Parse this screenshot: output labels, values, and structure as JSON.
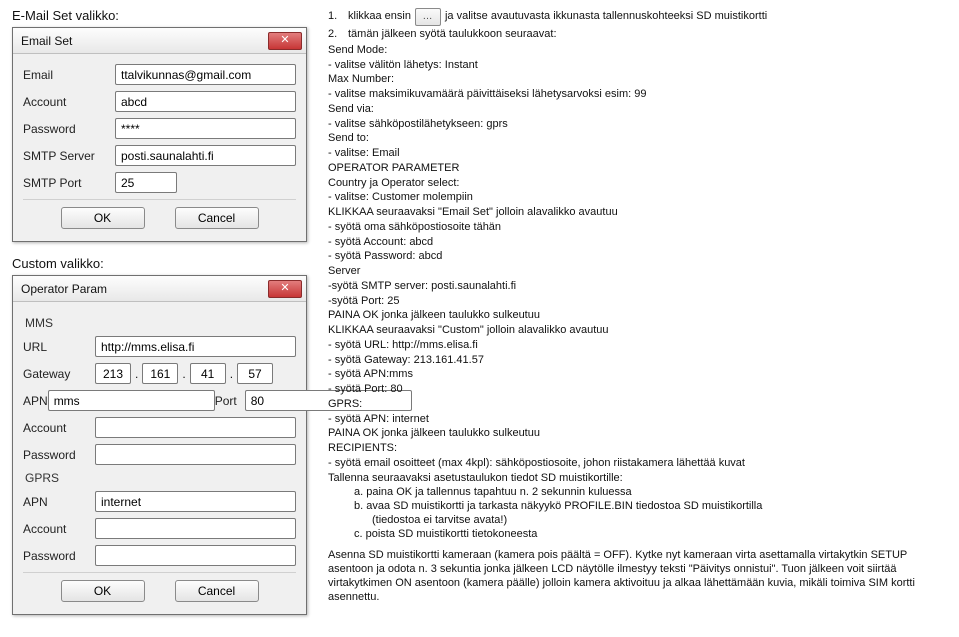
{
  "labels": {
    "email_set_valikko": "E-Mail Set valikko:",
    "custom_valikko": "Custom valikko:"
  },
  "email_dialog": {
    "title": "Email Set",
    "fields": {
      "email_label": "Email",
      "email_value": "ttalvikunnas@gmail.com",
      "account_label": "Account",
      "account_value": "abcd",
      "password_label": "Password",
      "password_value": "****",
      "smtp_label": "SMTP Server",
      "smtp_value": "posti.saunalahti.fi",
      "port_label": "SMTP Port",
      "port_value": "25"
    },
    "ok": "OK",
    "cancel": "Cancel"
  },
  "operator_dialog": {
    "title": "Operator Param",
    "mms_group": "MMS",
    "gprs_group": "GPRS",
    "fields": {
      "url_label": "URL",
      "url_value": "http://mms.elisa.fi",
      "gateway_label": "Gateway",
      "gw1": "213",
      "gw2": "161",
      "gw3": "41",
      "gw4": "57",
      "apn_label": "APN",
      "apn_value": "mms",
      "port_label": "Port",
      "port_value": "80",
      "account_label": "Account",
      "account_value": "",
      "password_label": "Password",
      "password_value": "",
      "gprs_apn_label": "APN",
      "gprs_apn_value": "internet",
      "gprs_account_label": "Account",
      "gprs_account_value": "",
      "gprs_password_label": "Password",
      "gprs_password_value": ""
    },
    "ok": "OK",
    "cancel": "Cancel"
  },
  "instructions": {
    "step1_pre": "klikkaa ensin",
    "step1_btn": "…",
    "step1_post": "ja valitse avautuvasta ikkunasta tallennuskohteeksi SD muistikortti",
    "step2": "tämän jälkeen syötä taulukkoon seuraavat:",
    "lines": [
      "Send Mode:",
      "- valitse välitön lähetys: Instant",
      "Max Number:",
      "- valitse maksimikuvamäärä päivittäiseksi lähetysarvoksi esim: 99",
      "Send via:",
      "- valitse sähköpostilähetykseen: gprs",
      "Send to:",
      "- valitse: Email",
      "OPERATOR PARAMETER",
      "Country ja Operator select:",
      "- valitse: Customer molempiin",
      "KLIKKAA seuraavaksi \"Email Set\" jolloin alavalikko avautuu",
      "- syötä oma sähköpostiosoite tähän",
      "- syötä Account: abcd",
      " - syötä Password: abcd",
      "Server",
      "-syötä SMTP server: posti.saunalahti.fi",
      "-syötä Port: 25",
      "PAINA OK jonka jälkeen taulukko sulkeutuu",
      "KLIKKAA seuraavaksi \"Custom\" jolloin alavalikko avautuu",
      "- syötä URL: http://mms.elisa.fi",
      "- syötä Gateway: 213.161.41.57",
      "- syötä APN:mms",
      "- syötä Port: 80",
      "GPRS:",
      "- syötä APN: internet",
      "PAINA OK jonka jälkeen taulukko sulkeutuu",
      "RECIPIENTS:",
      "- syötä email osoitteet (max 4kpl): sähköpostiosoite, johon riistakamera lähettää kuvat",
      "Tallenna seuraavaksi asetustaulukon tiedot SD muistikortille:"
    ],
    "sub_a": "a.   paina OK  ja tallennus tapahtuu n. 2 sekunnin kuluessa",
    "sub_b": "b.   avaa SD muistikortti ja tarkasta näkyykö PROFILE.BIN tiedostoa SD muistikortilla",
    "sub_b2": "(tiedostoa ei tarvitse avata!)",
    "sub_c": "c.   poista SD muistikortti tietokoneesta",
    "footer": "Asenna SD muistikortti kameraan (kamera pois päältä = OFF). Kytke nyt kameraan virta asettamalla virtakytkin SETUP asentoon ja odota n. 3 sekuntia jonka jälkeen LCD näytölle ilmestyy teksti \"Päivitys onnistui\". Tuon jälkeen voit siirtää virtakytkimen ON asentoon (kamera päälle) jolloin kamera aktivoituu ja alkaa lähettämään kuvia, mikäli toimiva SIM kortti asennettu."
  }
}
